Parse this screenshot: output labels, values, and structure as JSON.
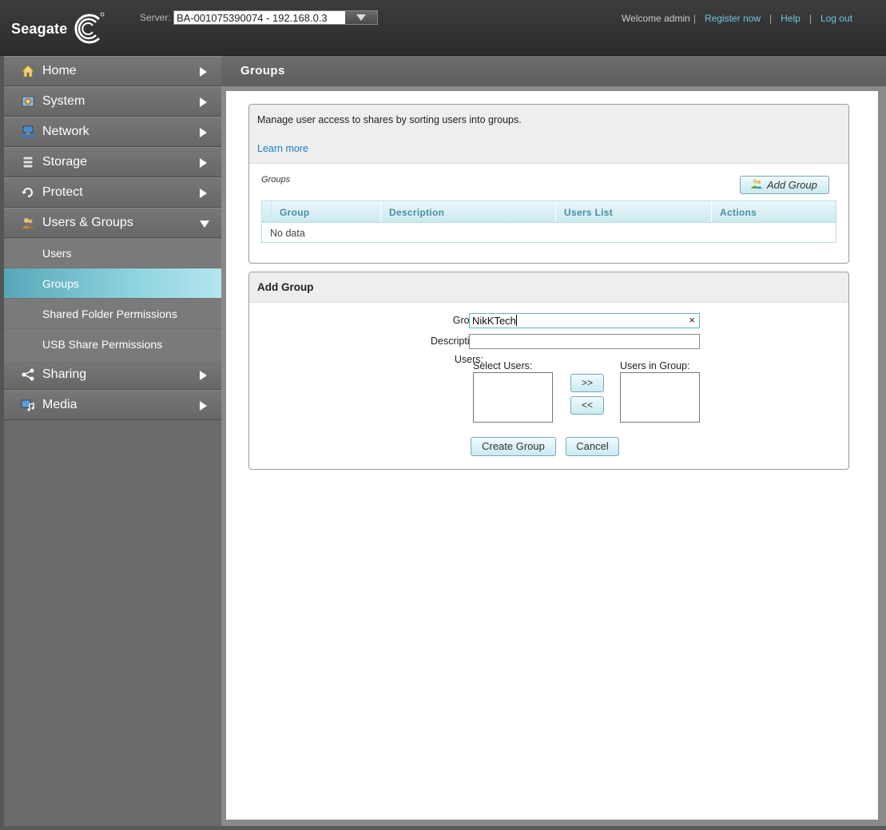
{
  "header": {
    "logo_text": "Seagate",
    "server_label": "Server:",
    "server_value": "BA-001075390074 - 192.168.0.3",
    "welcome": "Welcome admin",
    "links": [
      "Register now",
      "Help",
      "Log out"
    ]
  },
  "sidebar": {
    "items": [
      {
        "label": "Home",
        "icon": "home-icon"
      },
      {
        "label": "System",
        "icon": "gear-icon"
      },
      {
        "label": "Network",
        "icon": "network-icon"
      },
      {
        "label": "Storage",
        "icon": "database-icon"
      },
      {
        "label": "Protect",
        "icon": "restore-icon"
      },
      {
        "label": "Users & Groups",
        "icon": "users-icon"
      },
      {
        "label": "Sharing",
        "icon": "share-icon"
      },
      {
        "label": "Media",
        "icon": "media-icon"
      }
    ],
    "subitems": [
      "Users",
      "Groups",
      "Shared Folder Permissions",
      "USB Share Permissions"
    ],
    "active_sub": "Groups"
  },
  "page": {
    "title": "Groups"
  },
  "groups_panel": {
    "intro": "Manage user access to shares by sorting users into groups.",
    "learn_more": "Learn more",
    "table_label": "Groups",
    "add_button": "Add Group",
    "columns": [
      "Group",
      "Description",
      "Users List",
      "Actions"
    ],
    "empty_text": "No data"
  },
  "add_group_form": {
    "title": "Add Group",
    "group_label": "Group:",
    "group_value": "NikKTech",
    "clear_symbol": "×",
    "description_label": "Description:",
    "description_value": "",
    "users_label": "Users:",
    "select_users_label": "Select Users:",
    "users_in_group_label": "Users in Group:",
    "add_user_symbol": ">>",
    "remove_user_symbol": "<<",
    "create_button": "Create Group",
    "cancel_button": "Cancel"
  },
  "colors": {
    "accent": "#6ec6df",
    "active_nav": "#8fd3e0",
    "link": "#1a7fc0"
  }
}
